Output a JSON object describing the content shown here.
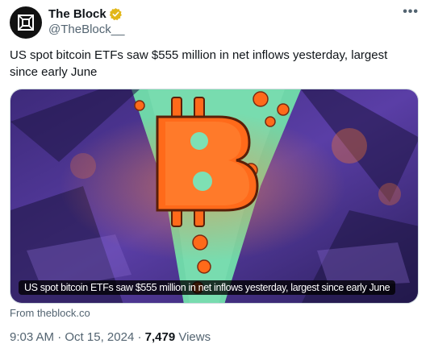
{
  "author": {
    "display_name": "The Block",
    "handle": "@TheBlock__",
    "verified_color": "#e2b719"
  },
  "tweet": {
    "text": "US spot bitcoin ETFs saw $555 million in net inflows yesterday, largest since early June"
  },
  "media": {
    "caption": "US spot bitcoin ETFs saw $555 million in net inflows yesterday, largest since early June",
    "source": "From theblock.co",
    "accent_color": "#ff6a1a"
  },
  "meta": {
    "time": "9:03 AM",
    "date": "Oct 15, 2024",
    "views_count": "7,479",
    "views_label": "Views"
  }
}
